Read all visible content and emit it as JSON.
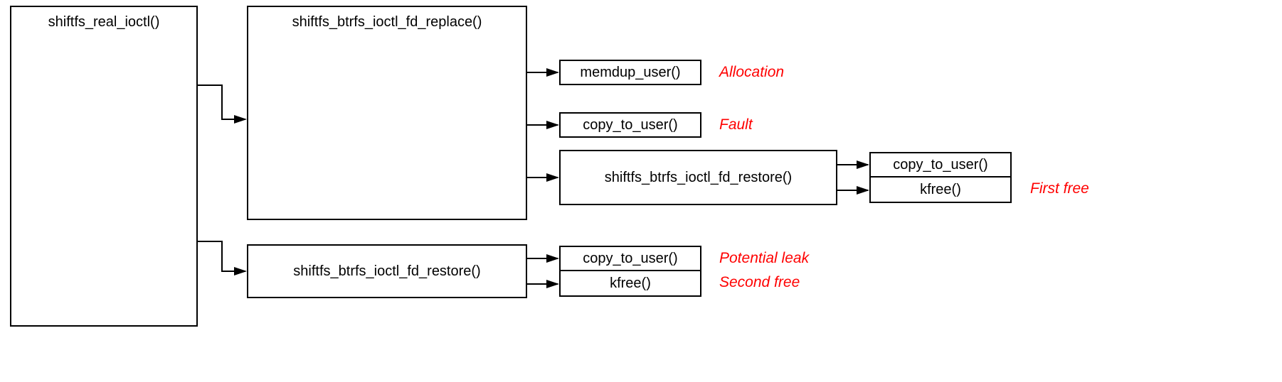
{
  "diagram": {
    "root": "shiftfs_real_ioctl()",
    "replace": "shiftfs_btrfs_ioctl_fd_replace()",
    "memdup": "memdup_user()",
    "copy1": "copy_to_user()",
    "restore_inner": "shiftfs_btrfs_ioctl_fd_restore()",
    "copy_inner": "copy_to_user()",
    "kfree_inner": "kfree()",
    "restore_outer": "shiftfs_btrfs_ioctl_fd_restore()",
    "copy_outer": "copy_to_user()",
    "kfree_outer": "kfree()",
    "ann_alloc": "Allocation",
    "ann_fault": "Fault",
    "ann_ptleak": "Potential leak",
    "ann_second": "Second free",
    "ann_first": "First free"
  }
}
